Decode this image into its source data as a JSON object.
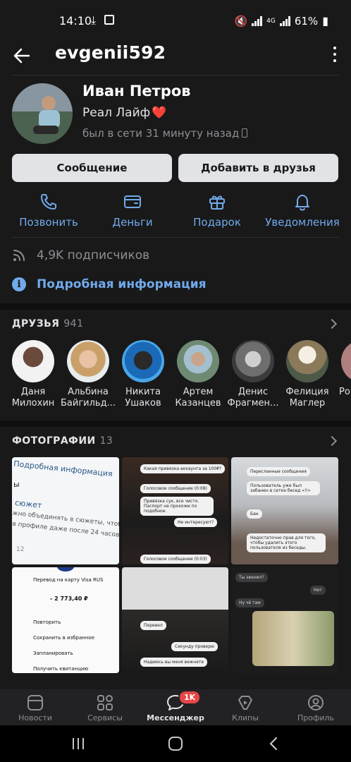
{
  "status_bar": {
    "time": "14:10",
    "network": "4G",
    "battery": "61%"
  },
  "header": {
    "title": "evgenii592"
  },
  "profile": {
    "name": "Иван Петров",
    "status": "Реал Лайф",
    "status_emoji": "❤️",
    "online": "был в сети 31 минуту назад"
  },
  "buttons": {
    "message": "Сообщение",
    "add_friend": "Добавить в друзья"
  },
  "actions": [
    {
      "label": "Позвонить",
      "icon": "phone-icon"
    },
    {
      "label": "Деньги",
      "icon": "wallet-icon"
    },
    {
      "label": "Подарок",
      "icon": "gift-icon"
    },
    {
      "label": "Уведомления",
      "icon": "bell-icon"
    }
  ],
  "info": {
    "subscribers": "4,9K подписчиков",
    "details": "Подробная информация"
  },
  "friends": {
    "title": "ДРУЗЬЯ",
    "count": "941",
    "items": [
      {
        "line1": "Даня",
        "line2": "Милохин"
      },
      {
        "line1": "Альбина",
        "line2": "Байгильд..."
      },
      {
        "line1": "Никита",
        "line2": "Ушаков"
      },
      {
        "line1": "Артем",
        "line2": "Казанцев"
      },
      {
        "line1": "Денис",
        "line2": "Фрагмен..."
      },
      {
        "line1": "Фелиция",
        "line2": "Маглер"
      },
      {
        "line1": "",
        "line2": "Ро"
      }
    ]
  },
  "photos": {
    "title": "ФОТОГРАФИИ",
    "count": "13",
    "p1": {
      "l1": "Подробная информация",
      "l2": "ы",
      "l3": "сюжет",
      "l4": "жно объединять в сюжеты, чтобы он",
      "l5": "в профиле даже после 24 часов.",
      "l6": "12"
    },
    "p2": {
      "b1": "Какая привязка аккаунта за 100₽?",
      "b2": "Голосовое сообщение (0:08)",
      "b3": "Привязка сук, все чисто. Паспорт не прохожи по подобное.",
      "b4": "Не интересуют?",
      "b5": "Голосовое сообщение (0:03)"
    },
    "p3": {
      "b1": "Пересланные сообщения",
      "b2": "Пользователь уже был забанен в сетке бесед «!!»",
      "b3": "Бан",
      "b4": "Недостаточно прав для того, чтобы удалить этого пользователя из беседы."
    },
    "p4": {
      "t1": "Перевод на карту Visa RUS",
      "t2": "- 2 773,40 ₽",
      "m1": "Повторить",
      "m2": "Сохранить в избранное",
      "m3": "Запланировать",
      "m4": "Получить квитанцию"
    },
    "p5": {
      "b1": "Перевел",
      "b2": "Секунду проверю",
      "b3": "Надеюсь вы меня вежнете"
    },
    "p6": {
      "b1": "Ты звонил?",
      "b2": "Нет",
      "b3": "Ну чё там"
    }
  },
  "tabs": [
    {
      "label": "Новости",
      "icon": "news-icon"
    },
    {
      "label": "Сервисы",
      "icon": "services-icon"
    },
    {
      "label": "Мессенджер",
      "icon": "messenger-icon",
      "badge": "1K"
    },
    {
      "label": "Клипы",
      "icon": "clips-icon"
    },
    {
      "label": "Профиль",
      "icon": "profile-icon"
    }
  ],
  "colors": {
    "background": "#19191a",
    "accent": "#71aaeb",
    "badge": "#e64646"
  }
}
